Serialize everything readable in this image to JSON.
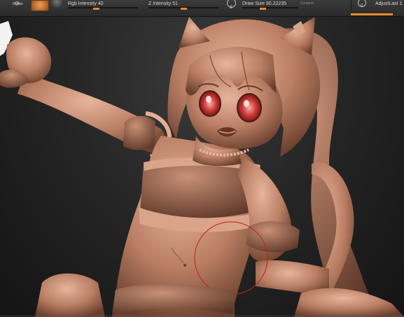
{
  "toolbar": {
    "rotate_label": "Rotate",
    "rgb_intensity": {
      "label": "Rgb Intensity",
      "value": "40",
      "level": 0.4
    },
    "z_intensity": {
      "label": "Z Intensity",
      "value": "51",
      "level": 0.51
    },
    "symmetry_label": "S",
    "draw_size": {
      "label": "Draw Size",
      "value": "90.22235",
      "level": 0.35
    },
    "dynamic_label": "Dynamic",
    "brush_index": "0",
    "adjust_last": {
      "label": "AdjustLast",
      "value": "1"
    }
  },
  "colors": {
    "accent": "#e58a2a",
    "clay": "#c98b6e",
    "background": "#1e1e1e",
    "eye": "#d23b3b"
  },
  "canvas": {
    "subject": "sculpted clay figure"
  }
}
